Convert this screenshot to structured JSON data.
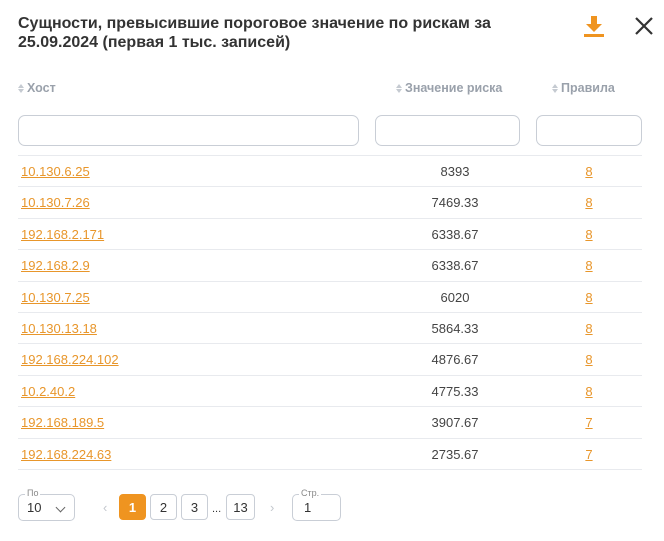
{
  "modal": {
    "title": "Сущности, превысившие пороговое значение по рискам за 25.09.2024 (первая 1 тыс. записей)",
    "download_icon": "download-icon",
    "close_icon": "close-icon",
    "accent_color": "#ef9420"
  },
  "table": {
    "columns": [
      {
        "label": "Хост"
      },
      {
        "label": "Значение риска"
      },
      {
        "label": "Правила"
      }
    ],
    "filters": {
      "host": "",
      "risk": "",
      "rules": ""
    },
    "rows": [
      {
        "host": "10.130.6.25",
        "risk": "8393",
        "rules": "8"
      },
      {
        "host": "10.130.7.26",
        "risk": "7469.33",
        "rules": "8"
      },
      {
        "host": "192.168.2.171",
        "risk": "6338.67",
        "rules": "8"
      },
      {
        "host": "192.168.2.9",
        "risk": "6338.67",
        "rules": "8"
      },
      {
        "host": "10.130.7.25",
        "risk": "6020",
        "rules": "8"
      },
      {
        "host": "10.130.13.18",
        "risk": "5864.33",
        "rules": "8"
      },
      {
        "host": "192.168.224.102",
        "risk": "4876.67",
        "rules": "8"
      },
      {
        "host": "10.2.40.2",
        "risk": "4775.33",
        "rules": "8"
      },
      {
        "host": "192.168.189.5",
        "risk": "3907.67",
        "rules": "7"
      },
      {
        "host": "192.168.224.63",
        "risk": "2735.67",
        "rules": "7"
      }
    ]
  },
  "pagination": {
    "per_page_label": "По",
    "per_page_value": "10",
    "prev": "‹",
    "next": "›",
    "pages": [
      "1",
      "2",
      "3",
      "13"
    ],
    "ellipsis": "...",
    "current_page": "1",
    "page_input_label": "Стр.",
    "page_input_value": "1"
  }
}
